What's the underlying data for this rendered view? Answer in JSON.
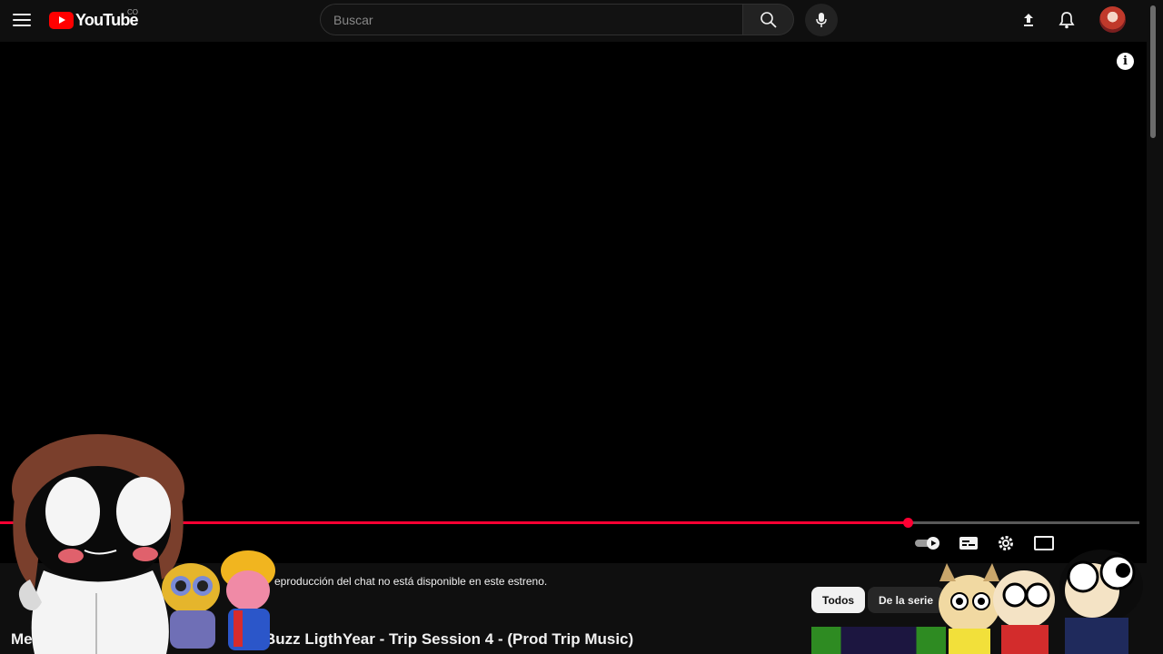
{
  "header": {
    "logo_text": "YouTube",
    "logo_country": "CO",
    "search_placeholder": "Buscar"
  },
  "player": {
    "progress_fraction": 0.797
  },
  "below_player": {
    "chat_notice": "eproducción del chat no está disponible en este estreno.",
    "title_start": "Me",
    "video_title": "Buzz LigthYear - Trip Session 4 - (Prod Trip Music)",
    "chips": [
      "Todos",
      "De la serie"
    ]
  },
  "colors": {
    "accent": "#ff0033",
    "logo_red": "#ff0000",
    "background": "#0f0f0f"
  },
  "icons": [
    "menu-icon",
    "search-icon",
    "microphone-icon",
    "upload-icon",
    "bell-icon",
    "info-icon",
    "autoplay-toggle-icon",
    "subtitles-icon",
    "settings-gear-icon",
    "miniplayer-icon"
  ]
}
